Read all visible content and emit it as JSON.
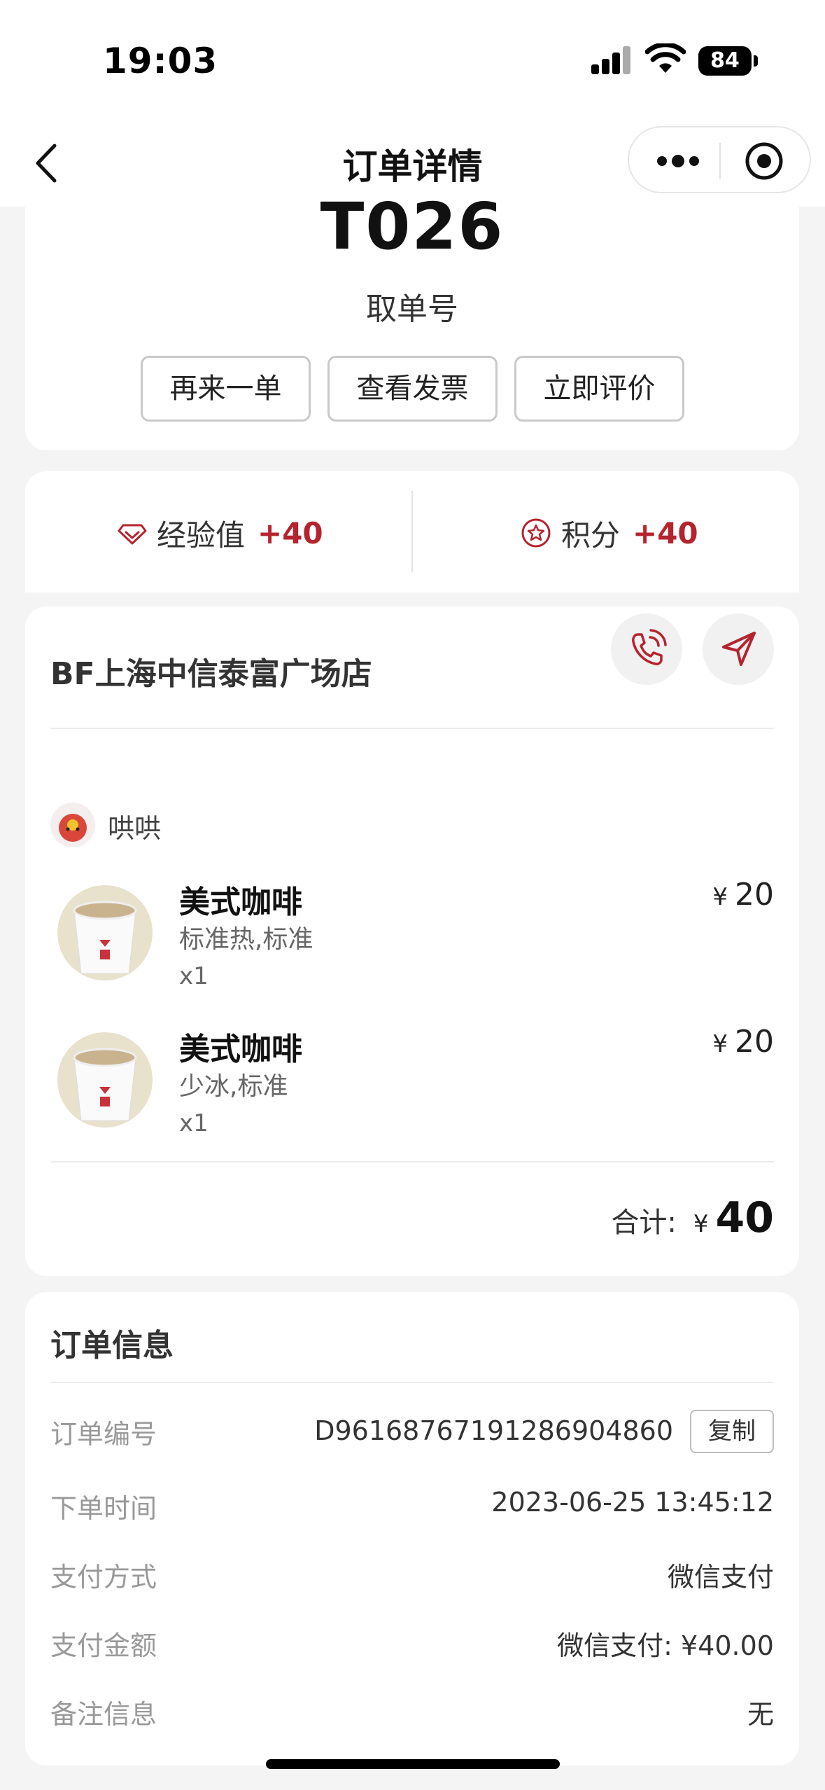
{
  "status_bar": {
    "time": "19:03",
    "battery": "84"
  },
  "nav": {
    "title": "订单详情"
  },
  "order_header": {
    "pickup_code": "T026",
    "pickup_label": "取单号",
    "buttons": [
      "再来一单",
      "查看发票",
      "立即评价"
    ]
  },
  "rewards": {
    "exp_label": "经验值",
    "exp_value": "+40",
    "points_label": "积分",
    "points_value": "+40"
  },
  "store": {
    "name": "BF上海中信泰富广场店",
    "user_name": "哄哄",
    "items": [
      {
        "name": "美式咖啡",
        "spec": "标准热,标准",
        "qty": "x1",
        "price": "20",
        "currency": "¥"
      },
      {
        "name": "美式咖啡",
        "spec": "少冰,标准",
        "qty": "x1",
        "price": "20",
        "currency": "¥"
      }
    ],
    "total_label": "合计:",
    "total_currency": "¥",
    "total_value": "40"
  },
  "order_info": {
    "title": "订单信息",
    "rows": [
      {
        "label": "订单编号",
        "value": "D961687671912869048​60"
      },
      {
        "label": "下单时间",
        "value": "2023-06-25 13:45:12"
      },
      {
        "label": "支付方式",
        "value": "微信支付"
      },
      {
        "label": "支付金额",
        "value": "微信支付: ¥40.00"
      },
      {
        "label": "备注信息",
        "value": "无"
      }
    ],
    "copy_label": "复制"
  },
  "colors": {
    "accent": "#b5242e",
    "background": "#f4f4f4"
  }
}
